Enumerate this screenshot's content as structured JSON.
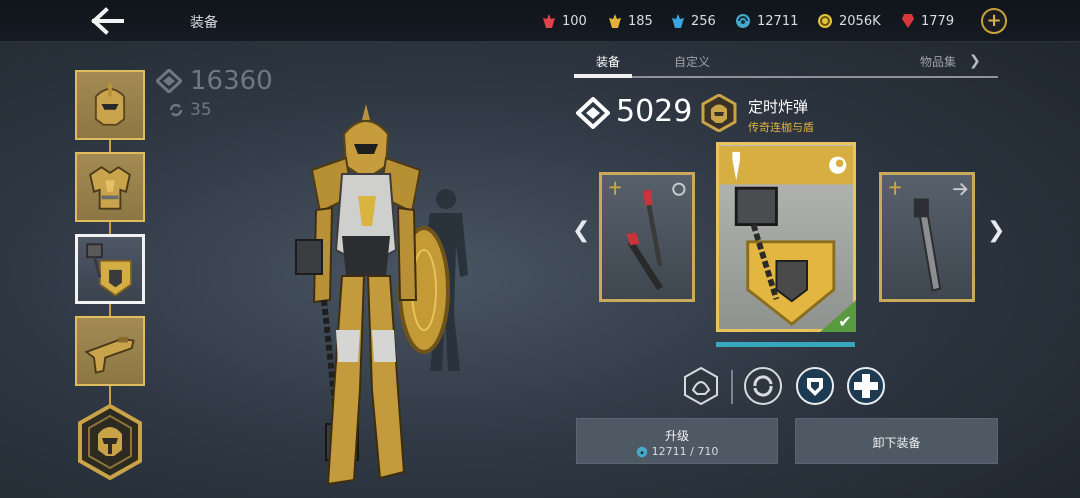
{
  "header": {
    "title": "装备",
    "resources": [
      {
        "icon": "red-gem-icon",
        "value": "100",
        "color": "#e0434a"
      },
      {
        "icon": "gold-gem-icon",
        "value": "185",
        "color": "#e3b13a"
      },
      {
        "icon": "blue-gem-icon",
        "value": "256",
        "color": "#3aa6e0"
      },
      {
        "icon": "orb-currency-icon",
        "value": "12711",
        "color": "#46a9c9"
      },
      {
        "icon": "coin-icon",
        "value": "2056K",
        "color": "#e5c23c"
      },
      {
        "icon": "ruby-icon",
        "value": "1779",
        "color": "#d8363c"
      }
    ]
  },
  "character": {
    "power": "16360",
    "level": "35"
  },
  "tabs": [
    {
      "label": "装备",
      "active": true
    },
    {
      "label": "自定义",
      "active": false
    },
    {
      "label": "物品集",
      "active": false
    }
  ],
  "item": {
    "power": "5029",
    "name": "定时炸弹",
    "type": "传奇连枷与盾",
    "upgrade_progress": 0.99
  },
  "buttons": {
    "upgrade_label": "升级",
    "upgrade_cost": "12711 / 710",
    "unequip_label": "卸下装备"
  },
  "colors": {
    "accent_gold": "#e2b43c",
    "legendary_card": "#e9c35c",
    "equipped_green": "#5a9a3e",
    "progress_teal": "#37a7bd"
  }
}
